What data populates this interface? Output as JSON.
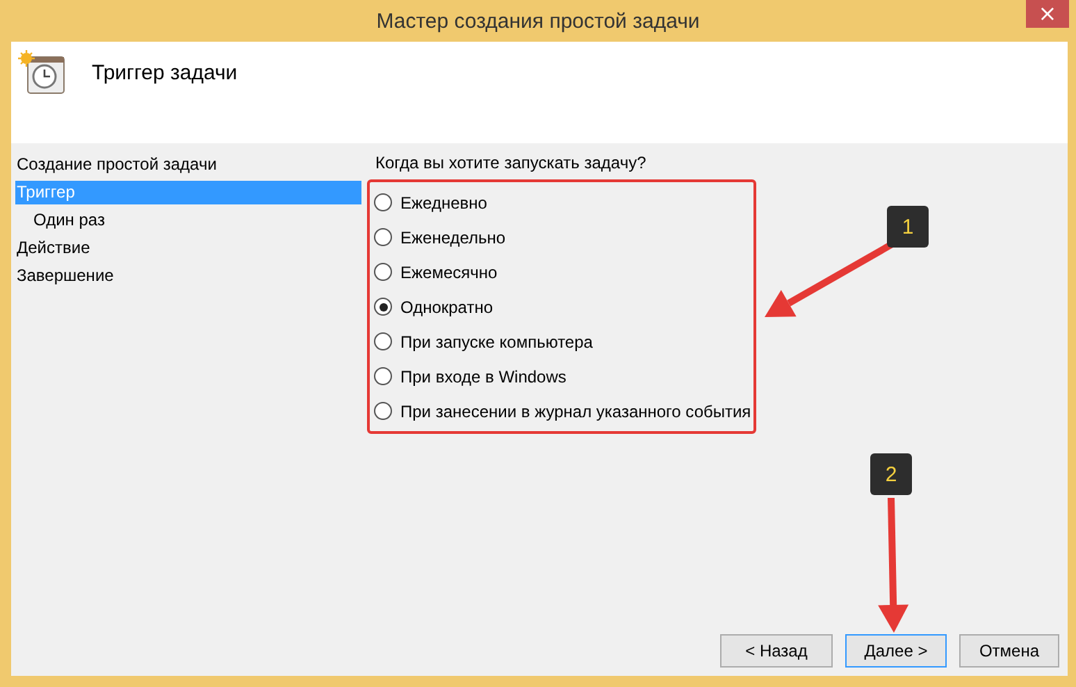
{
  "window": {
    "title": "Мастер создания простой задачи",
    "close": "×"
  },
  "header": {
    "title": "Триггер задачи"
  },
  "steps": [
    {
      "label": "Создание простой задачи",
      "selected": false
    },
    {
      "label": "Триггер",
      "selected": true,
      "children": [
        {
          "label": "Один раз",
          "selected": false
        }
      ]
    },
    {
      "label": "Действие",
      "selected": false
    },
    {
      "label": "Завершение",
      "selected": false
    }
  ],
  "question": "Когда вы хотите запускать задачу?",
  "options": [
    {
      "label": "Ежедневно",
      "selected": false
    },
    {
      "label": "Еженедельно",
      "selected": false
    },
    {
      "label": "Ежемесячно",
      "selected": false
    },
    {
      "label": "Однократно",
      "selected": true
    },
    {
      "label": "При запуске компьютера",
      "selected": false
    },
    {
      "label": "При входе в Windows",
      "selected": false
    },
    {
      "label": "При занесении в журнал указанного события",
      "selected": false
    }
  ],
  "buttons": [
    {
      "label": "< Назад",
      "focused": false
    },
    {
      "label": "Далее >",
      "focused": true
    },
    {
      "label": "Отмена",
      "focused": false
    }
  ],
  "annotations": [
    {
      "text": "1"
    },
    {
      "text": "2"
    }
  ]
}
